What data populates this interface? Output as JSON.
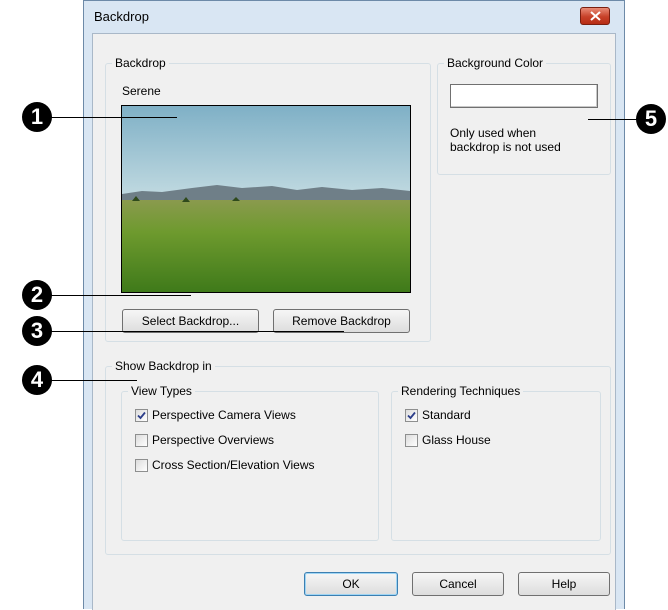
{
  "window": {
    "title": "Backdrop",
    "close_icon": "close-icon"
  },
  "backdrop_group": {
    "legend": "Backdrop",
    "backdrop_name": "Serene",
    "select_button": "Select Backdrop...",
    "remove_button": "Remove Backdrop"
  },
  "background_group": {
    "legend": "Background Color",
    "swatch_color": "#ffffff",
    "note_line1": "Only used when",
    "note_line2": "backdrop is not used"
  },
  "show_group": {
    "legend": "Show Backdrop in",
    "view_types": {
      "legend": "View Types",
      "items": [
        {
          "label": "Perspective Camera Views",
          "checked": true
        },
        {
          "label": "Perspective Overviews",
          "checked": false
        },
        {
          "label": "Cross Section/Elevation Views",
          "checked": false
        }
      ]
    },
    "rendering": {
      "legend": "Rendering Techniques",
      "items": [
        {
          "label": "Standard",
          "checked": true
        },
        {
          "label": "Glass House",
          "checked": false
        }
      ]
    }
  },
  "buttons": {
    "ok": "OK",
    "cancel": "Cancel",
    "help": "Help"
  },
  "callouts": [
    "1",
    "2",
    "3",
    "4",
    "5"
  ]
}
